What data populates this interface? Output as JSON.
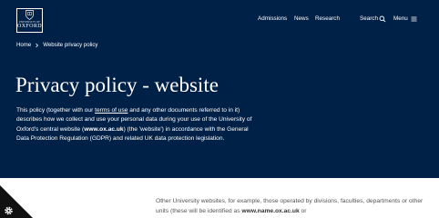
{
  "logo": {
    "line1": "UNIVERSITY OF",
    "line2": "OXFORD"
  },
  "nav": {
    "admissions": "Admissions",
    "news": "News",
    "research": "Research",
    "search": "Search",
    "menu": "Menu"
  },
  "breadcrumb": {
    "home": "Home",
    "current": "Website privacy policy"
  },
  "title": "Privacy policy - website",
  "intro": {
    "p1": "This policy (together with our ",
    "link": "terms of use",
    "p2": " and any other documents referred to in it) describes how we collect and use your personal data during your use of the University of Oxford's central website (",
    "url": "www.ox.ac.uk",
    "p3": ") (the 'website') in accordance with the General Data Protection Regulation (GDPR) and related UK data protection legislation."
  },
  "body": {
    "p1": "Other University websites, for example, those operated by divisions, faculties, departments or other units (these will be identified as ",
    "url": "www.name.ox.ac.uk",
    "p2": " or"
  },
  "colors": {
    "navy": "#002147",
    "white": "#ffffff",
    "body_text": "#555555"
  },
  "icons": {
    "crest": "crest-icon",
    "search": "search-icon",
    "menu": "menu-icon",
    "breadcrumb": "chevron-right-icon",
    "cookie": "gear-icon"
  }
}
